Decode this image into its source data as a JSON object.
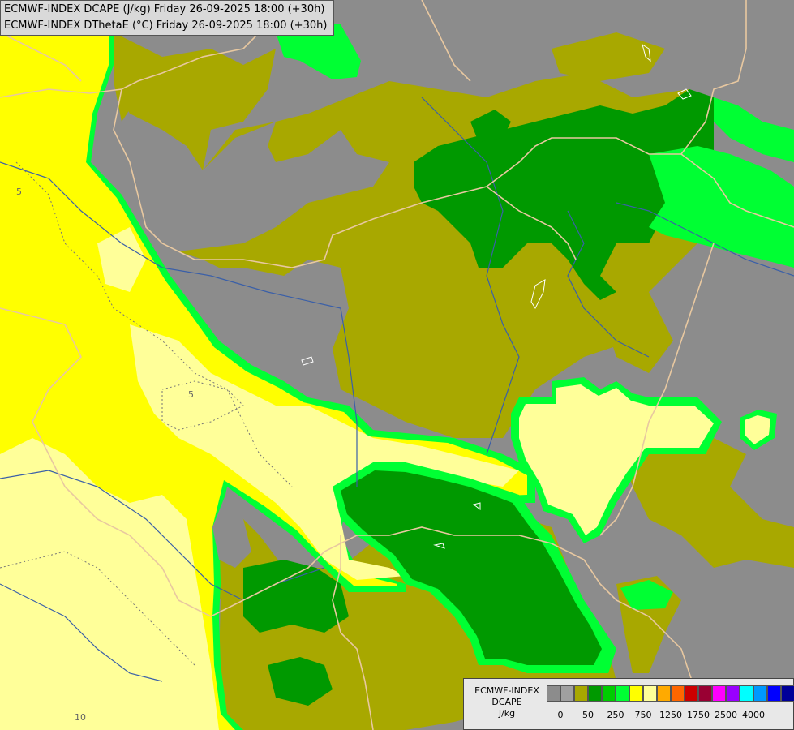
{
  "header": {
    "line1": "ECMWF-INDEX DCAPE (J/kg) Friday 26-09-2025 18:00 (+30h)",
    "line2": "ECMWF-INDEX DThetaE (°C) Friday 26-09-2025 18:00 (+30h)"
  },
  "legend": {
    "title_line1": "ECMWF-INDEX",
    "title_line2": "DCAPE",
    "unit": "J/kg",
    "colors": [
      "#8c8c8c",
      "#a0a0a0",
      "#a8a800",
      "#009900",
      "#00cc00",
      "#00ff33",
      "#ffff00",
      "#ffff99",
      "#ffaa00",
      "#ff6600",
      "#cc0000",
      "#990033",
      "#ff00ff",
      "#9900ff",
      "#00ffff",
      "#0099ff",
      "#0000ff",
      "#000099"
    ],
    "tick_labels": [
      "0",
      "50",
      "250",
      "750",
      "1250",
      "1750",
      "2500",
      "4000"
    ]
  },
  "contour_labels": [
    "5",
    "5",
    "10"
  ],
  "colors": {
    "background_gray": "#8c8c8c",
    "olive": "#a8a800",
    "dark_green": "#009900",
    "bright_green": "#00ff33",
    "yellow": "#ffff00",
    "pale_yellow": "#ffff99",
    "border_line": "#e8c8a0",
    "river": "#3a5fa8"
  }
}
